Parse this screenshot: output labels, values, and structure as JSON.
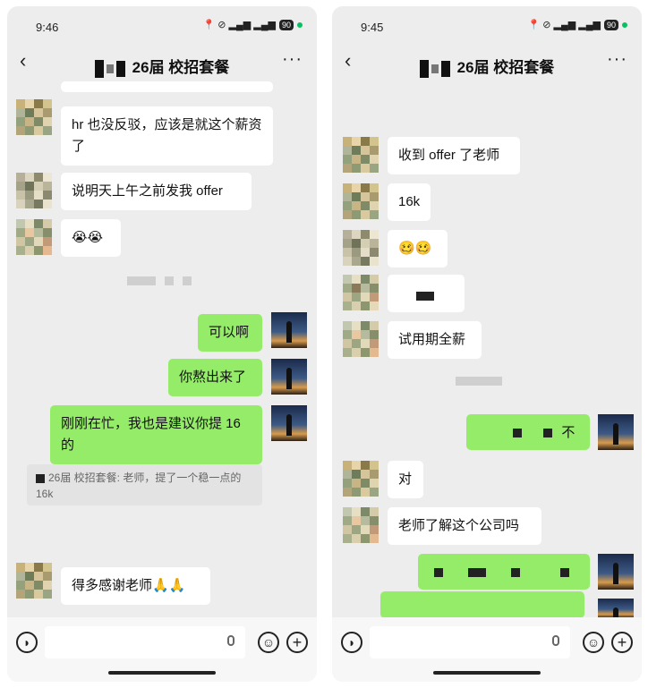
{
  "left": {
    "status_time": "9:46",
    "status_extra": "⬢ ···",
    "title": "26届 校招套餐",
    "messages": [
      "hr 也没反驳，应该是就这个薪资了",
      "说明天上午之前发我 offer",
      "😭😭",
      "可以啊",
      "你熬出来了",
      "刚刚在忙，我也是建议你提 16 的",
      "26届 校招套餐: 老师，提了一个稳一点的16k",
      "得多感谢老师🙏🙏"
    ],
    "battery": "90"
  },
  "right": {
    "status_time": "9:45",
    "title": "26届 校招套餐",
    "messages": [
      "收到 offer 了老师",
      "16k",
      "🥴🥴",
      "试用期全薪",
      "不",
      "对",
      "老师了解这个公司吗"
    ],
    "battery": "90"
  },
  "colors": {
    "bg": "#ededed",
    "green_bubble": "#95ec69",
    "white_bubble": "#ffffff"
  },
  "icons": [
    "back-icon",
    "more-icon",
    "voice-icon",
    "mic-icon",
    "emoji-icon",
    "plus-icon"
  ]
}
